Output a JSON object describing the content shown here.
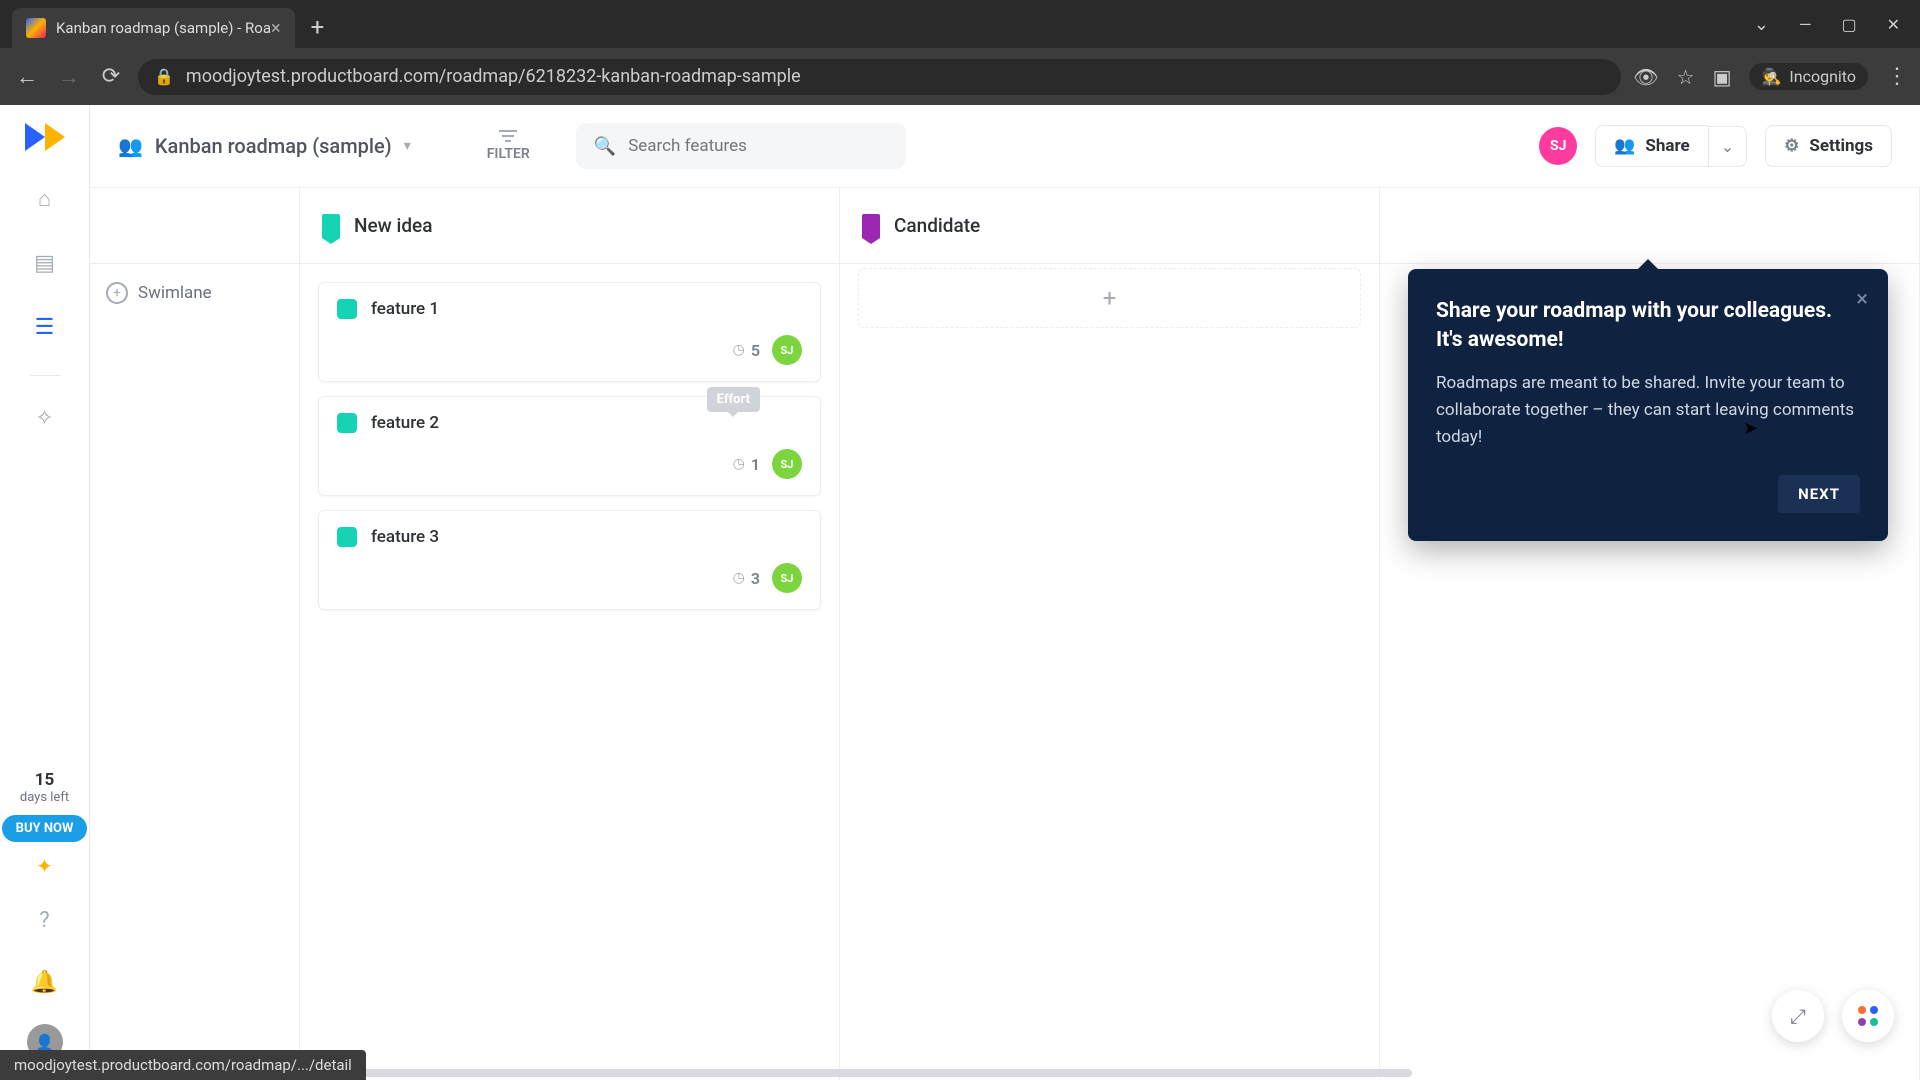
{
  "browser": {
    "tab_title": "Kanban roadmap (sample) - Roa",
    "url": "moodjoytest.productboard.com/roadmap/6218232-kanban-roadmap-sample",
    "incognito_label": "Incognito"
  },
  "header": {
    "board_title": "Kanban roadmap (sample)",
    "filter_label": "FILTER",
    "search_placeholder": "Search features",
    "avatar_initials": "SJ",
    "share_label": "Share",
    "settings_label": "Settings"
  },
  "trial": {
    "days": "15",
    "days_left_label": "days left",
    "buy_now_label": "BUY NOW"
  },
  "swimlane_label": "Swimlane",
  "columns": [
    {
      "id": "new-idea",
      "title": "New idea",
      "color": "teal"
    },
    {
      "id": "candidate",
      "title": "Candidate",
      "color": "purple"
    }
  ],
  "cards": {
    "new_idea": [
      {
        "name": "feature 1",
        "effort": "5",
        "avatar": "SJ"
      },
      {
        "name": "feature 2",
        "effort": "1",
        "avatar": "SJ",
        "tooltip": "Effort"
      },
      {
        "name": "feature 3",
        "effort": "3",
        "avatar": "SJ"
      }
    ]
  },
  "popover": {
    "title": "Share your roadmap with your colleagues. It's awesome!",
    "body": "Roadmaps are meant to be shared. Invite your team to collaborate together – they can start leaving comments today!",
    "next_label": "NEXT"
  },
  "status_bar": "moodjoytest.productboard.com/roadmap/.../detail"
}
